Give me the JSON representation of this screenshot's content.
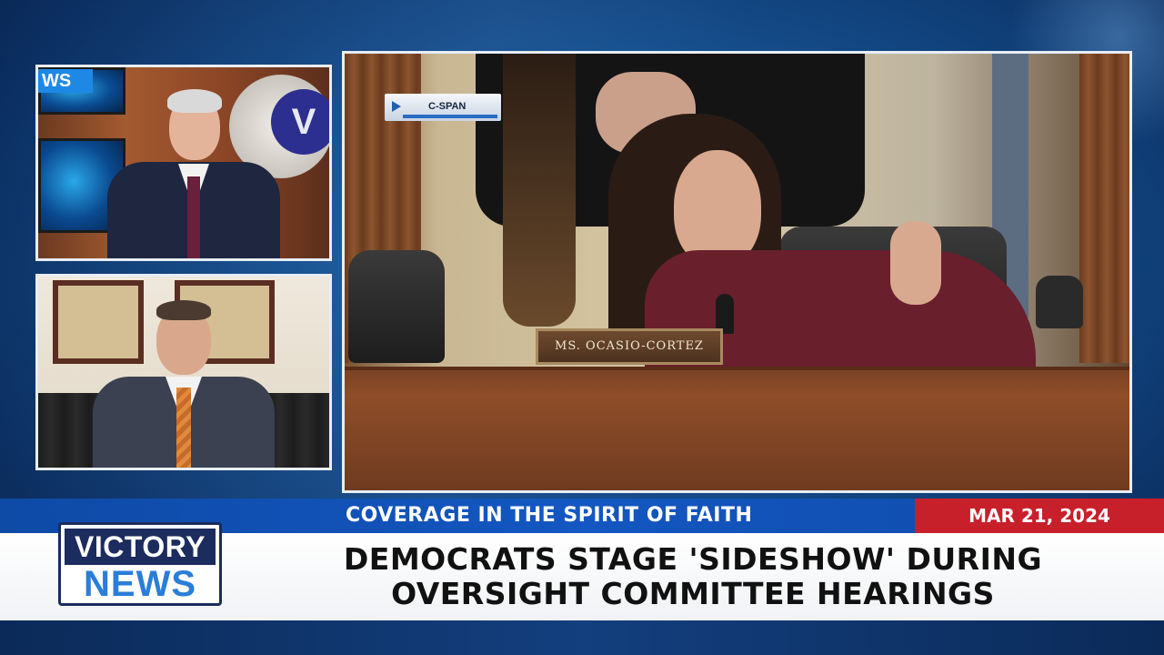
{
  "host_panel": {
    "screen_tag": "WS",
    "logo_letter": "V"
  },
  "main_video": {
    "source_badge": "C-SPAN",
    "nameplate": "MS. OCASIO-CORTEZ"
  },
  "lower_third": {
    "strapline": "COVERAGE IN THE SPIRIT OF FAITH",
    "date": "MAR 21, 2024",
    "headline_line1": "DEMOCRATS STAGE 'SIDESHOW' DURING",
    "headline_line2": "OVERSIGHT COMMITTEE HEARINGS"
  },
  "logo": {
    "top": "VICTORY",
    "bottom": "NEWS"
  },
  "colors": {
    "strap_blue": "#1457c2",
    "date_red": "#c8202b",
    "logo_navy": "#1c2c5e",
    "logo_blue": "#2a7ed8"
  }
}
